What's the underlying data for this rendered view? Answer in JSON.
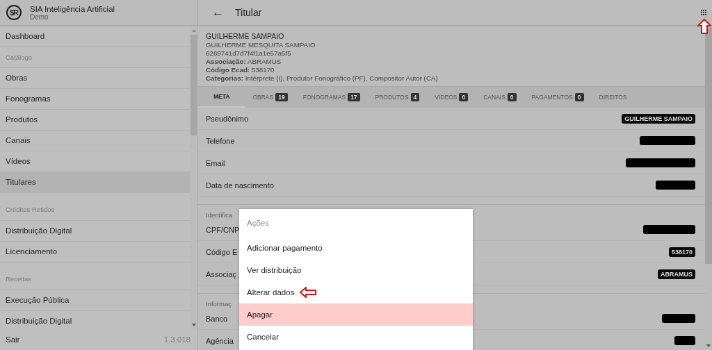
{
  "brand": {
    "logo_text": "$R",
    "name": "SIA Inteligência Artificial",
    "subtitle": "Demo"
  },
  "sidebar": {
    "items": [
      {
        "kind": "link",
        "label": "Dashboard",
        "selected": false
      },
      {
        "kind": "section",
        "label": "Catálogo"
      },
      {
        "kind": "link",
        "label": "Obras",
        "selected": false
      },
      {
        "kind": "link",
        "label": "Fonogramas",
        "selected": false
      },
      {
        "kind": "link",
        "label": "Produtos",
        "selected": false
      },
      {
        "kind": "link",
        "label": "Canais",
        "selected": false
      },
      {
        "kind": "link",
        "label": "Vídeos",
        "selected": false
      },
      {
        "kind": "link",
        "label": "Titulares",
        "selected": true
      },
      {
        "kind": "section",
        "label": "Créditos Retidos"
      },
      {
        "kind": "link",
        "label": "Distribuição Digital",
        "selected": false
      },
      {
        "kind": "link",
        "label": "Licenciamento",
        "selected": false
      },
      {
        "kind": "section",
        "label": "Receitas"
      },
      {
        "kind": "link",
        "label": "Execução Pública",
        "selected": false
      },
      {
        "kind": "link",
        "label": "Distribuição Digital",
        "selected": false
      }
    ],
    "footer": {
      "logout": "Sair",
      "version": "1.3.018"
    }
  },
  "app_bar": {
    "back": "←",
    "title": "Titular",
    "apps_marked": true
  },
  "profile": {
    "name": "GUILHERME SAMPAIO",
    "full_name": "GUILHERME MESQUITA SAMPAIO",
    "id": "6269741d7d7f4f1a1e57a5f5",
    "facts": [
      {
        "label": "Associação:",
        "value": "ABRAMUS"
      },
      {
        "label": "Código Ecad:",
        "value": "538170"
      },
      {
        "label": "Categorias:",
        "value": "Intérprete (I), Produtor Fonográfico (PF), Compositor Autor (CA)"
      }
    ]
  },
  "tabs": [
    {
      "label": "META",
      "selected": true
    },
    {
      "label": "OBRAS",
      "count": "19",
      "selected": false
    },
    {
      "label": "FONOGRAMAS",
      "count": "17",
      "selected": false
    },
    {
      "label": "PRODUTOS",
      "count": "4",
      "selected": false
    },
    {
      "label": "VÍDEOS",
      "count": "0",
      "selected": false
    },
    {
      "label": "CANAIS",
      "count": "0",
      "selected": false
    },
    {
      "label": "PAGAMENTOS",
      "count": "0",
      "selected": false
    },
    {
      "label": "DIREITOS",
      "selected": false
    }
  ],
  "sections": [
    {
      "rows": [
        {
          "label": "Pseudônimo",
          "kind": "badge",
          "value": "GUILHERME SAMPAIO"
        },
        {
          "label": "Telefone",
          "kind": "redacted"
        },
        {
          "label": "Email",
          "kind": "redacted"
        },
        {
          "label": "Data de nascimento",
          "kind": "redacted"
        }
      ]
    },
    {
      "title": "Identifica",
      "rows": [
        {
          "label": "CPF/CNP",
          "kind": "redacted"
        },
        {
          "label": "Código E",
          "kind": "badge",
          "value": "538170"
        },
        {
          "label": "Associaç",
          "kind": "badge",
          "value": "ABRAMUS"
        }
      ]
    },
    {
      "title": "Informaç",
      "rows": [
        {
          "label": "Banco",
          "kind": "redacted"
        },
        {
          "label": "Agência",
          "kind": "redacted"
        }
      ]
    }
  ],
  "action_sheet": {
    "title": "Ações",
    "items": [
      {
        "label": "Adicionar pagamento",
        "selected": false,
        "marked": false
      },
      {
        "label": "Ver distribuição",
        "selected": false,
        "marked": false
      },
      {
        "label": "Alterar dados",
        "selected": false,
        "marked": true
      },
      {
        "label": "Apagar",
        "selected": true,
        "marked": false
      },
      {
        "label": "Cancelar",
        "selected": false,
        "marked": false
      }
    ]
  }
}
